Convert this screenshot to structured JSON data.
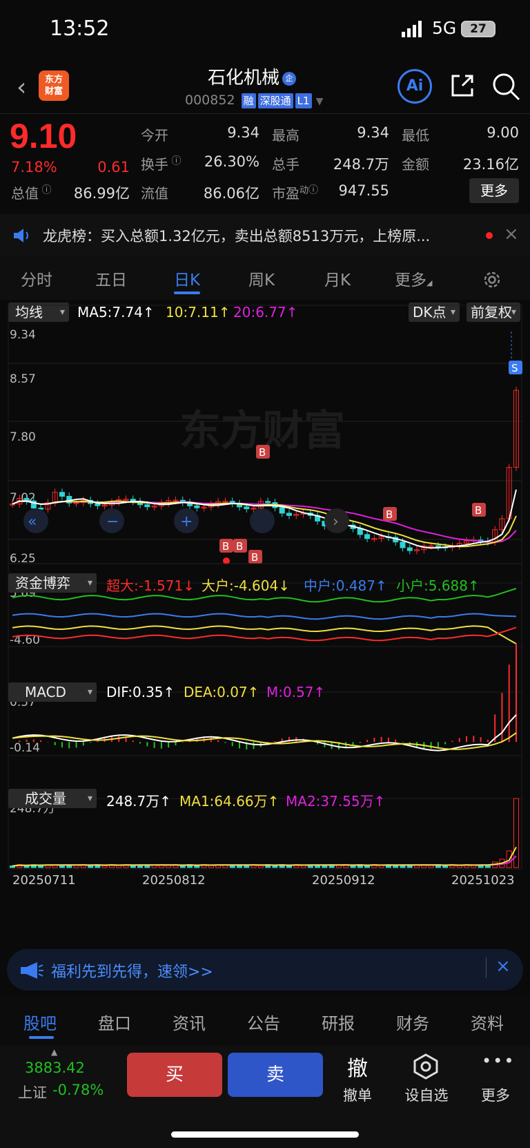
{
  "status": {
    "time": "13:52",
    "network": "5G",
    "battery": "27"
  },
  "header": {
    "stock_name": "石化机械",
    "badge": "企",
    "code": "000852",
    "tags": [
      "融",
      "深股通",
      "L1"
    ],
    "ai_label": "Ai"
  },
  "quote": {
    "price": "9.10",
    "change_pct": "7.18%",
    "change": "0.61",
    "fields": [
      {
        "label": "今开",
        "value": "9.34",
        "color": "red"
      },
      {
        "label": "最高",
        "value": "9.34",
        "color": "red"
      },
      {
        "label": "最低",
        "value": "9.00",
        "color": "red"
      },
      {
        "label": "换手",
        "value": "26.30%",
        "color": "white"
      },
      {
        "label": "总手",
        "value": "248.7万",
        "color": "white"
      },
      {
        "label": "金额",
        "value": "23.16亿",
        "color": "white"
      },
      {
        "label": "总值",
        "value": "86.99亿",
        "color": "white"
      },
      {
        "label": "流值",
        "value": "86.06亿",
        "color": "white"
      },
      {
        "label": "市盈",
        "sup": "动",
        "value": "947.55",
        "color": "white"
      }
    ],
    "more": "更多"
  },
  "news": {
    "text": "龙虎榜：买入总额1.32亿元，卖出总额8513万元，上榜原..."
  },
  "period_tabs": [
    "分时",
    "五日",
    "日K",
    "周K",
    "月K",
    "更多"
  ],
  "active_period": "日K",
  "kline": {
    "selector": "均线",
    "ma5": "MA5:7.74↑",
    "ma10": "10:7.11↑",
    "ma20": "20:6.77↑",
    "dk_button": "DK点",
    "adjust_button": "前复权",
    "y_labels": [
      "9.34",
      "8.57",
      "7.80",
      "7.02",
      "6.25"
    ],
    "watermark": "东方财富"
  },
  "fund": {
    "selector": "资金博弈",
    "super_large": "超大:-1.571↓",
    "large": "大户:-4.604↓",
    "medium": "中户:0.487↑",
    "small": "小户:5.688↑",
    "y_top": "5.69",
    "y_bottom": "-4.60"
  },
  "macd": {
    "selector": "MACD",
    "dif": "DIF:0.35↑",
    "dea": "DEA:0.07↑",
    "m": "M:0.57↑",
    "y_top": "0.57",
    "y_bottom": "-0.14"
  },
  "volume": {
    "selector": "成交量",
    "vol": "248.7万↑",
    "ma1": "MA1:64.66万↑",
    "ma2": "MA2:37.55万↑",
    "y_top": "248.7万"
  },
  "dates": [
    "20250711",
    "20250812",
    "20250912",
    "20251023"
  ],
  "promo": {
    "text": "福利先到先得，速领>>"
  },
  "bottom_tabs": [
    "股吧",
    "盘口",
    "资讯",
    "公告",
    "研报",
    "财务",
    "资料"
  ],
  "footer": {
    "index_value": "3883.42",
    "index_name": "上证",
    "index_change": "-0.78%",
    "buy": "买",
    "sell": "卖",
    "cancel_icon": "撤",
    "cancel": "撤单",
    "watch": "设自选",
    "more": "更多"
  },
  "colors": {
    "up": "#ff2a2a",
    "down": "#2ed4d4",
    "accent": "#3a7cf0"
  }
}
